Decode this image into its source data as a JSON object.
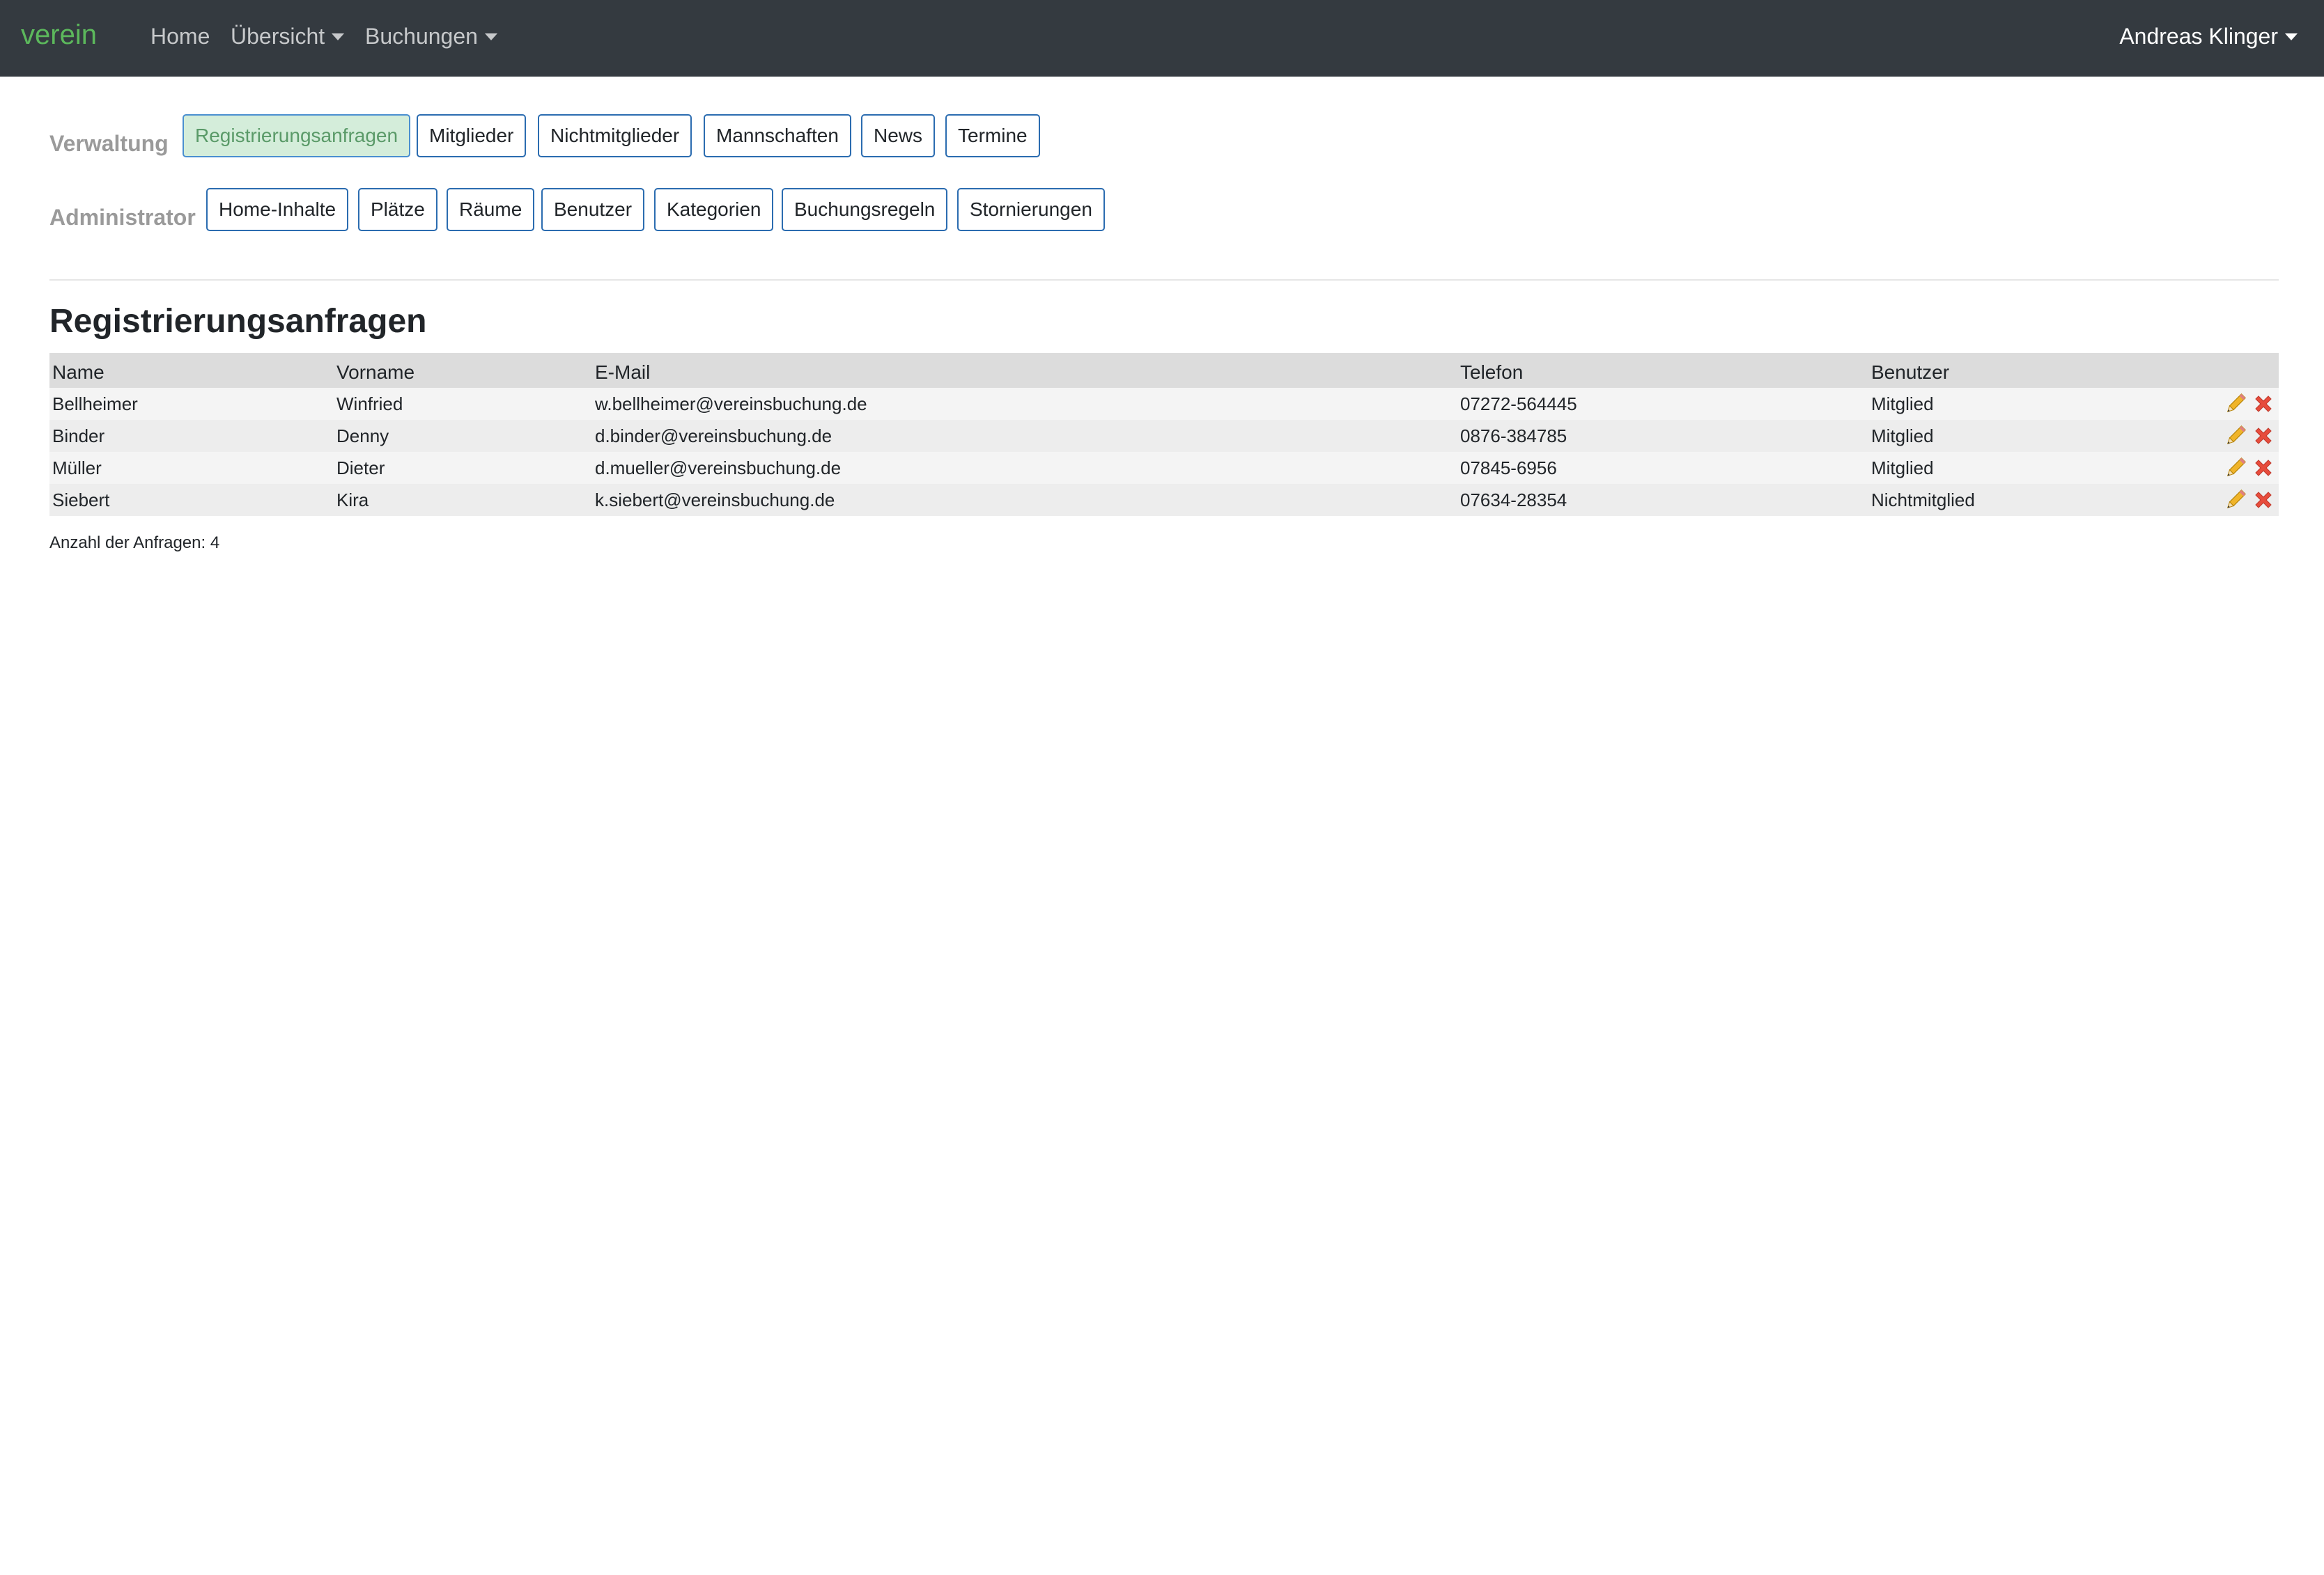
{
  "navbar": {
    "brand": "verein",
    "items": [
      {
        "label": "Home"
      },
      {
        "label": "Übersicht"
      },
      {
        "label": "Buchungen"
      }
    ],
    "user": "Andreas Klinger"
  },
  "verwaltung": {
    "label": "Verwaltung",
    "buttons": [
      "Registrierungsanfragen",
      "Mitglieder",
      "Nichtmitglieder",
      "Mannschaften",
      "News",
      "Termine"
    ],
    "active": "Registrierungsanfragen"
  },
  "administrator": {
    "label": "Administrator",
    "buttons": [
      "Home-Inhalte",
      "Plätze",
      "Räume",
      "Benutzer",
      "Kategorien",
      "Buchungsregeln",
      "Stornierungen"
    ]
  },
  "section": {
    "title": "Registrierungsanfragen"
  },
  "table": {
    "headers": {
      "name": "Name",
      "vorname": "Vorname",
      "email": "E-Mail",
      "telefon": "Telefon",
      "benutzer": "Benutzer"
    },
    "rows": [
      {
        "name": "Bellheimer",
        "vorname": "Winfried",
        "email": "w.bellheimer@vereinsbuchung.de",
        "telefon": "07272-564445",
        "benutzer": "Mitglied"
      },
      {
        "name": "Binder",
        "vorname": "Denny",
        "email": "d.binder@vereinsbuchung.de",
        "telefon": "0876-384785",
        "benutzer": "Mitglied"
      },
      {
        "name": "Müller",
        "vorname": "Dieter",
        "email": "d.mueller@vereinsbuchung.de",
        "telefon": "07845-6956",
        "benutzer": "Mitglied"
      },
      {
        "name": "Siebert",
        "vorname": "Kira",
        "email": "k.siebert@vereinsbuchung.de",
        "telefon": "07634-28354",
        "benutzer": "Nichtmitglied"
      }
    ],
    "icons": {
      "edit": "pencil-icon",
      "delete": "delete-x-icon"
    }
  },
  "footer": {
    "count": "Anzahl der Anfragen: 4"
  },
  "colors": {
    "navbar": "#343a40",
    "brand": "#5cb85c",
    "button_border": "#2b6cb0",
    "active_bg": "#d4edda",
    "delete": "#e74c3c",
    "edit": "#f0b429"
  }
}
